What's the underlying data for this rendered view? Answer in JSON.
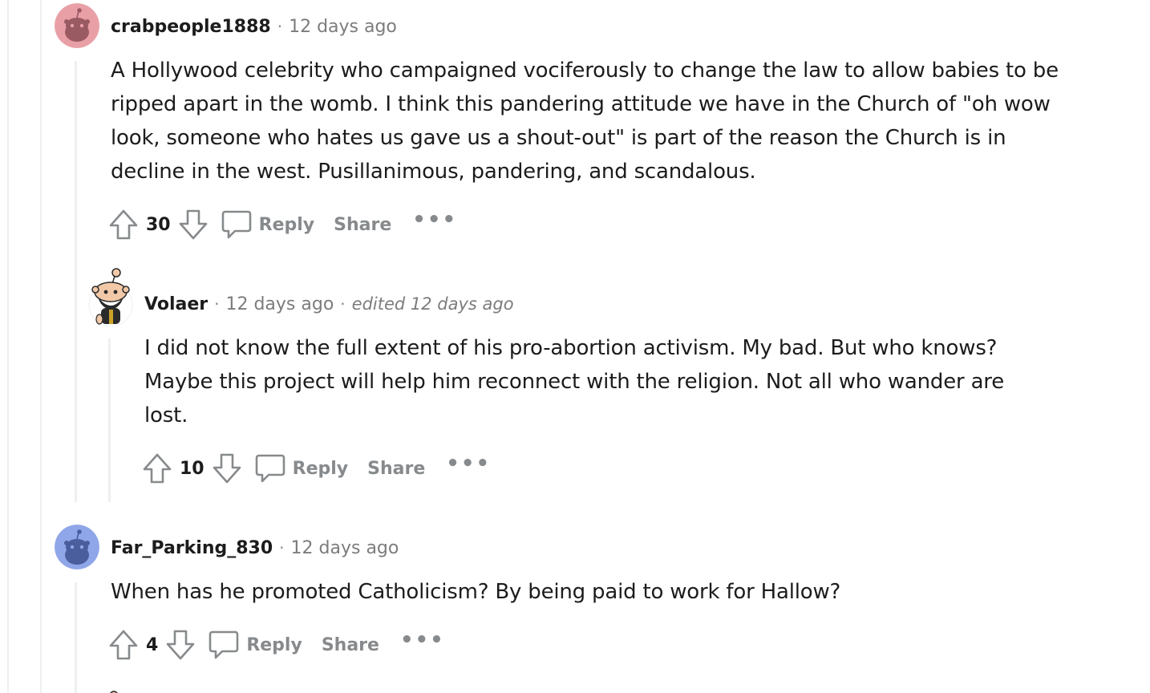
{
  "comments": [
    {
      "username": "crabpeople1888",
      "timestamp": "12 days ago",
      "body": "A Hollywood celebrity who campaigned vociferously to change the law to allow babies to be ripped apart in the womb. I think this pandering attitude we have in the Church of \"oh wow look, someone who hates us gave us a shout-out\" is part of the reason the Church is in decline in the west. Pusillanimous, pandering, and scandalous.",
      "score": "30",
      "reply_label": "Reply",
      "share_label": "Share",
      "more_label": "•••",
      "avatar_color": "#e8a0a6"
    },
    {
      "username": "Volaer",
      "timestamp": "12 days ago",
      "edited": "edited 12 days ago",
      "body": "I did not know the full extent of his pro-abortion activism. My bad. But who knows? Maybe this project will help him reconnect with the religion. Not all who wander are lost.",
      "score": "10",
      "reply_label": "Reply",
      "share_label": "Share",
      "more_label": "•••"
    },
    {
      "username": "Far_Parking_830",
      "timestamp": "12 days ago",
      "body": "When has he promoted Catholicism? By being paid to work for Hallow?",
      "score": "4",
      "reply_label": "Reply",
      "share_label": "Share",
      "more_label": "•••",
      "avatar_color": "#8fa6e8"
    }
  ],
  "separator": "·",
  "icons": {
    "upvote": "arrow-up-icon",
    "downvote": "arrow-down-icon",
    "reply": "comment-bubble-icon",
    "more": "ellipsis-icon"
  }
}
